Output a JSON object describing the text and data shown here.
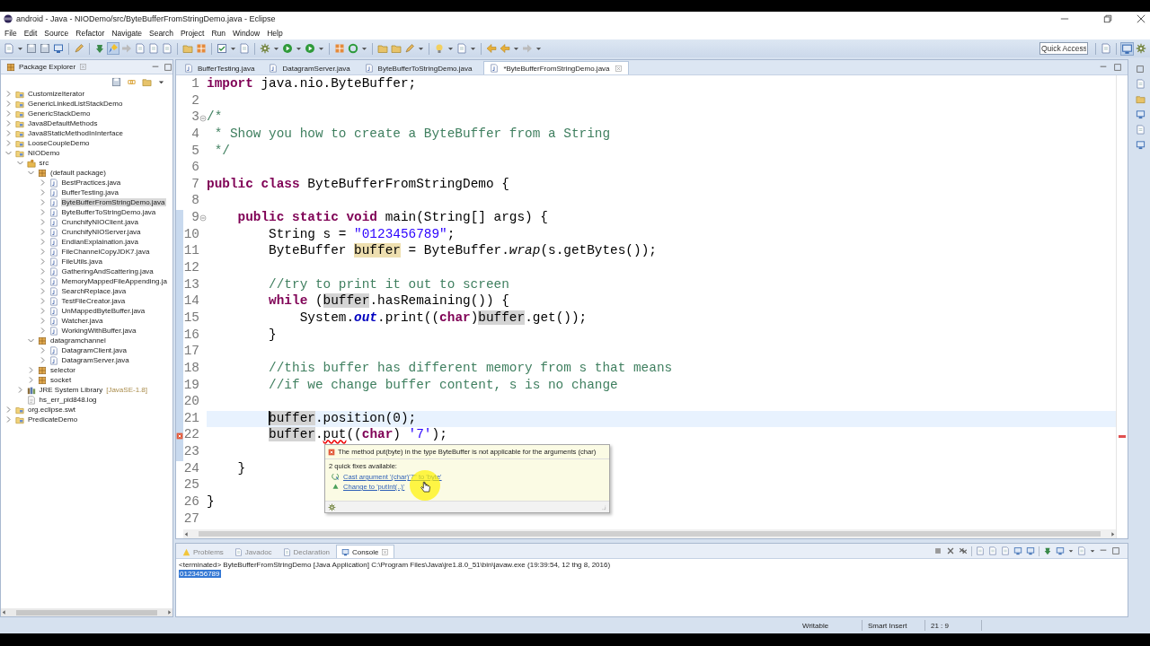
{
  "window": {
    "title": "android - Java - NIODemo/src/ByteBufferFromStringDemo.java - Eclipse"
  },
  "menu": [
    "File",
    "Edit",
    "Source",
    "Refactor",
    "Navigate",
    "Search",
    "Project",
    "Run",
    "Window",
    "Help"
  ],
  "quick_access": {
    "placeholder": "Quick Access"
  },
  "package_explorer": {
    "title": "Package Explorer",
    "tree": [
      {
        "label": "CustomizeIterator",
        "kind": "project",
        "expanded": false,
        "selected": false
      },
      {
        "label": "GenericLinkedListStackDemo",
        "kind": "project",
        "expanded": false,
        "selected": false
      },
      {
        "label": "GenericStackDemo",
        "kind": "project",
        "expanded": false,
        "selected": false
      },
      {
        "label": "Java8DefaultMethods",
        "kind": "project",
        "expanded": false,
        "selected": false
      },
      {
        "label": "Java8StaticMethodInInterface",
        "kind": "project",
        "expanded": false,
        "selected": false
      },
      {
        "label": "LooseCoupleDemo",
        "kind": "project",
        "expanded": false,
        "selected": false
      },
      {
        "label": "NIODemo",
        "kind": "project",
        "expanded": true,
        "selected": false,
        "children": [
          {
            "label": "src",
            "kind": "source-folder",
            "expanded": true,
            "selected": false,
            "children": [
              {
                "label": "(default package)",
                "kind": "package",
                "expanded": true,
                "selected": false,
                "children": [
                  {
                    "label": "BestPractices.java",
                    "kind": "file",
                    "expanded": false,
                    "selected": false
                  },
                  {
                    "label": "BufferTesting.java",
                    "kind": "file",
                    "expanded": false,
                    "selected": false
                  },
                  {
                    "label": "ByteBufferFromStringDemo.java",
                    "kind": "file",
                    "expanded": false,
                    "selected": true
                  },
                  {
                    "label": "ByteBufferToStringDemo.java",
                    "kind": "file",
                    "expanded": false,
                    "selected": false
                  },
                  {
                    "label": "CrunchifyNIOClient.java",
                    "kind": "file",
                    "expanded": false,
                    "selected": false
                  },
                  {
                    "label": "CrunchifyNIOServer.java",
                    "kind": "file",
                    "expanded": false,
                    "selected": false
                  },
                  {
                    "label": "EndianExplaination.java",
                    "kind": "file",
                    "expanded": false,
                    "selected": false
                  },
                  {
                    "label": "FileChannelCopyJDK7.java",
                    "kind": "file",
                    "expanded": false,
                    "selected": false
                  },
                  {
                    "label": "FileUtils.java",
                    "kind": "file",
                    "expanded": false,
                    "selected": false
                  },
                  {
                    "label": "GatheringAndScattering.java",
                    "kind": "file",
                    "expanded": false,
                    "selected": false
                  },
                  {
                    "label": "MemoryMappedFileAppending.ja",
                    "kind": "file",
                    "expanded": false,
                    "selected": false
                  },
                  {
                    "label": "SearchReplace.java",
                    "kind": "file",
                    "expanded": false,
                    "selected": false
                  },
                  {
                    "label": "TestFileCreator.java",
                    "kind": "file",
                    "expanded": false,
                    "selected": false
                  },
                  {
                    "label": "UnMappedByteBuffer.java",
                    "kind": "file",
                    "expanded": false,
                    "selected": false
                  },
                  {
                    "label": "Watcher.java",
                    "kind": "file",
                    "expanded": false,
                    "selected": false
                  },
                  {
                    "label": "WorkingWithBuffer.java",
                    "kind": "file",
                    "expanded": false,
                    "selected": false
                  }
                ]
              },
              {
                "label": "datagramchannel",
                "kind": "package",
                "expanded": true,
                "selected": false,
                "children": [
                  {
                    "label": "DatagramClient.java",
                    "kind": "file",
                    "expanded": false,
                    "selected": false
                  },
                  {
                    "label": "DatagramServer.java",
                    "kind": "file",
                    "expanded": false,
                    "selected": false
                  }
                ]
              },
              {
                "label": "selector",
                "kind": "package",
                "expanded": false,
                "selected": false
              },
              {
                "label": "socket",
                "kind": "package",
                "expanded": false,
                "selected": false
              }
            ]
          },
          {
            "label": "JRE System Library",
            "decoration": "[JavaSE-1.8]",
            "kind": "library",
            "expanded": false,
            "selected": false
          },
          {
            "label": "hs_err_pid848.log",
            "kind": "log",
            "expanded": false,
            "selected": false
          }
        ]
      },
      {
        "label": "org.eclipse.swt",
        "kind": "project",
        "expanded": false,
        "selected": false
      },
      {
        "label": "PredicateDemo",
        "kind": "project",
        "expanded": false,
        "selected": false
      }
    ]
  },
  "editor": {
    "tabs": [
      {
        "label": "BufferTesting.java",
        "selected": false
      },
      {
        "label": "DatagramServer.java",
        "selected": false
      },
      {
        "label": "ByteBufferToStringDemo.java",
        "selected": false
      },
      {
        "label": "*ByteBufferFromStringDemo.java",
        "selected": true
      }
    ],
    "lines": [
      {
        "number": "1",
        "fold": false,
        "error": false,
        "current": false,
        "in_range": false,
        "tokens": [
          {
            "kind": "keyword",
            "text": "import"
          },
          {
            "kind": "plain",
            "text": " java.nio.ByteBuffer;"
          }
        ]
      },
      {
        "number": "2",
        "fold": false,
        "error": false,
        "current": false,
        "in_range": false
      },
      {
        "number": "3",
        "fold": true,
        "error": false,
        "current": false,
        "in_range": false,
        "tokens": [
          {
            "kind": "comment",
            "text": "/*"
          }
        ]
      },
      {
        "number": "4",
        "fold": false,
        "error": false,
        "current": false,
        "in_range": false,
        "tokens": [
          {
            "kind": "comment",
            "text": " * Show you how to create a ByteBuffer from a String"
          }
        ]
      },
      {
        "number": "5",
        "fold": false,
        "error": false,
        "current": false,
        "in_range": false,
        "tokens": [
          {
            "kind": "comment",
            "text": " */"
          }
        ]
      },
      {
        "number": "6",
        "fold": false,
        "error": false,
        "current": false,
        "in_range": false
      },
      {
        "number": "7",
        "fold": false,
        "error": false,
        "current": false,
        "in_range": false,
        "tokens": [
          {
            "kind": "keyword",
            "text": "public class"
          },
          {
            "kind": "plain",
            "text": " ByteBufferFromStringDemo {"
          }
        ]
      },
      {
        "number": "8",
        "fold": false,
        "error": false,
        "current": false,
        "in_range": false
      },
      {
        "number": "9",
        "fold": true,
        "error": false,
        "current": false,
        "in_range": true,
        "tokens": [
          {
            "kind": "keyword",
            "text": "    public static void"
          },
          {
            "kind": "plain",
            "text": " main(String[] args) {"
          }
        ]
      },
      {
        "number": "10",
        "fold": false,
        "error": false,
        "current": false,
        "in_range": true,
        "tokens": [
          {
            "kind": "plain",
            "text": "        String s = "
          },
          {
            "kind": "string",
            "text": "\"0123456789\""
          },
          {
            "kind": "plain",
            "text": ";"
          }
        ]
      },
      {
        "number": "11",
        "fold": false,
        "error": false,
        "current": false,
        "in_range": true,
        "tokens": [
          {
            "kind": "plain",
            "text": "        ByteBuffer "
          },
          {
            "kind": "write-occurrence",
            "text": "buffer"
          },
          {
            "kind": "plain",
            "text": " = ByteBuffer."
          },
          {
            "kind": "static-method",
            "text": "wrap"
          },
          {
            "kind": "plain",
            "text": "(s.getBytes());"
          }
        ]
      },
      {
        "number": "12",
        "fold": false,
        "error": false,
        "current": false,
        "in_range": true
      },
      {
        "number": "13",
        "fold": false,
        "error": false,
        "current": false,
        "in_range": true,
        "tokens": [
          {
            "kind": "comment",
            "text": "        //try to print it out to screen"
          }
        ]
      },
      {
        "number": "14",
        "fold": false,
        "error": false,
        "current": false,
        "in_range": true,
        "tokens": [
          {
            "kind": "keyword",
            "text": "        while"
          },
          {
            "kind": "plain",
            "text": " ("
          },
          {
            "kind": "occurrence",
            "text": "buffer"
          },
          {
            "kind": "plain",
            "text": ".hasRemaining()) {"
          }
        ]
      },
      {
        "number": "15",
        "fold": false,
        "error": false,
        "current": false,
        "in_range": true,
        "tokens": [
          {
            "kind": "plain",
            "text": "            System."
          },
          {
            "kind": "static-field",
            "text": "out"
          },
          {
            "kind": "plain",
            "text": ".print(("
          },
          {
            "kind": "keyword",
            "text": "char"
          },
          {
            "kind": "plain",
            "text": ")"
          },
          {
            "kind": "occurrence",
            "text": "buffer"
          },
          {
            "kind": "plain",
            "text": ".get());"
          }
        ]
      },
      {
        "number": "16",
        "fold": false,
        "error": false,
        "current": false,
        "in_range": true,
        "tokens": [
          {
            "kind": "plain",
            "text": "        }"
          }
        ]
      },
      {
        "number": "17",
        "fold": false,
        "error": false,
        "current": false,
        "in_range": true
      },
      {
        "number": "18",
        "fold": false,
        "error": false,
        "current": false,
        "in_range": true,
        "tokens": [
          {
            "kind": "comment",
            "text": "        //this buffer has different memory from s that means"
          }
        ]
      },
      {
        "number": "19",
        "fold": false,
        "error": false,
        "current": false,
        "in_range": true,
        "tokens": [
          {
            "kind": "comment",
            "text": "        //if we change buffer content, s is no change"
          }
        ]
      },
      {
        "number": "20",
        "fold": false,
        "error": false,
        "current": false,
        "in_range": true
      },
      {
        "number": "21",
        "fold": false,
        "error": false,
        "current": true,
        "in_range": true,
        "tokens": [
          {
            "kind": "occurrence-caret",
            "text": "        buffer"
          },
          {
            "kind": "plain",
            "text": ".position(0);"
          }
        ]
      },
      {
        "number": "22",
        "fold": false,
        "error": true,
        "current": false,
        "in_range": true,
        "tokens": [
          {
            "kind": "occurrence",
            "text": "        buffer"
          },
          {
            "kind": "plain",
            "text": "."
          },
          {
            "kind": "error",
            "text": "put"
          },
          {
            "kind": "plain",
            "text": "(("
          },
          {
            "kind": "keyword",
            "text": "char"
          },
          {
            "kind": "plain",
            "text": ") "
          },
          {
            "kind": "string",
            "text": "'7'"
          },
          {
            "kind": "plain",
            "text": ");"
          }
        ]
      },
      {
        "number": "23",
        "fold": false,
        "error": false,
        "current": false,
        "in_range": true
      },
      {
        "number": "24",
        "fold": false,
        "error": false,
        "current": false,
        "in_range": false,
        "tokens": [
          {
            "kind": "plain",
            "text": "    }"
          }
        ]
      },
      {
        "number": "25",
        "fold": false,
        "error": false,
        "current": false,
        "in_range": false
      },
      {
        "number": "26",
        "fold": false,
        "error": false,
        "current": false,
        "in_range": false,
        "tokens": [
          {
            "kind": "plain",
            "text": "}"
          }
        ]
      },
      {
        "number": "27",
        "fold": false,
        "error": false,
        "current": false,
        "in_range": false
      }
    ],
    "quick_fix": {
      "message": "The method put(byte) in the type ByteBuffer is not applicable for the arguments (char)",
      "count": "2 quick fixes available:",
      "fixes": [
        {
          "label": "Cast argument '(char)'7'' to 'byte'",
          "kind": "cast"
        },
        {
          "label": "Change to 'putInt(..)'",
          "kind": "rename"
        }
      ]
    }
  },
  "console": {
    "tabs": [
      {
        "label": "Problems",
        "kind": "problems",
        "selected": false
      },
      {
        "label": "Javadoc",
        "kind": "javadoc",
        "selected": false
      },
      {
        "label": "Declaration",
        "kind": "declaration",
        "selected": false
      },
      {
        "label": "Console",
        "kind": "console",
        "selected": true
      }
    ],
    "header": "<terminated> ByteBufferFromStringDemo [Java Application] C:\\Program Files\\Java\\jre1.8.0_51\\bin\\javaw.exe (19:39:54, 12 thg 8, 2016)",
    "output": [
      {
        "text": "0123456789",
        "selected": true
      }
    ]
  },
  "status_bar": [
    "Writable",
    "Smart Insert",
    "21 : 9"
  ]
}
